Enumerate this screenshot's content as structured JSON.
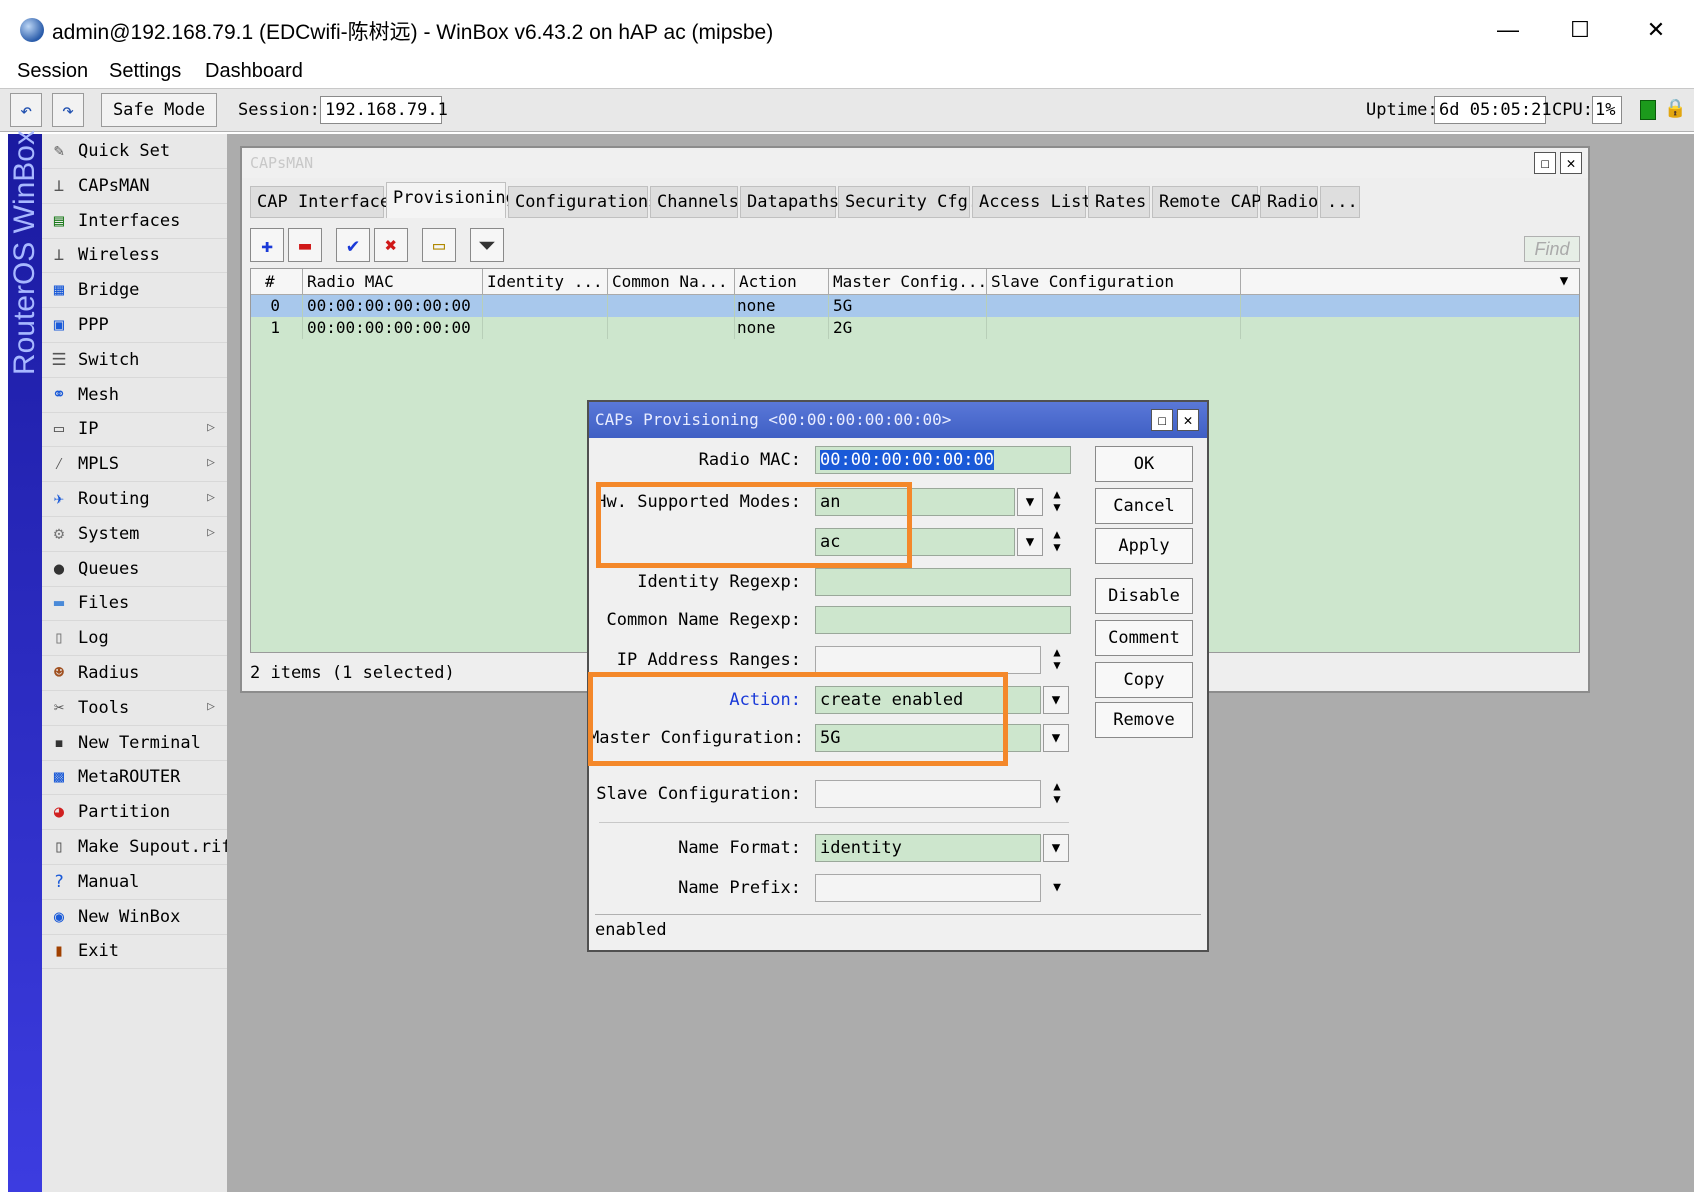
{
  "window": {
    "title": "admin@192.168.79.1 (EDCwifi-陈树远) - WinBox v6.43.2 on hAP ac (mipsbe)",
    "minimize": "—",
    "maximize": "☐",
    "close": "✕"
  },
  "menu": [
    "Session",
    "Settings",
    "Dashboard"
  ],
  "toolbar": {
    "undo": "↶",
    "redo": "↷",
    "safe_mode": "Safe Mode",
    "session_label": "Session:",
    "session_value": "192.168.79.1",
    "uptime_label": "Uptime:",
    "uptime_value": "6d 05:05:21",
    "cpu_label": "CPU:",
    "cpu_value": "1%"
  },
  "vertical_brand": "RouterOS WinBox",
  "sidebar": {
    "items": [
      {
        "label": "Quick Set",
        "icon": "✎",
        "submenu": false
      },
      {
        "label": "CAPsMAN",
        "icon": "⊥",
        "submenu": false
      },
      {
        "label": "Interfaces",
        "icon": "▤",
        "submenu": false
      },
      {
        "label": "Wireless",
        "icon": "⊥",
        "submenu": false
      },
      {
        "label": "Bridge",
        "icon": "▦",
        "submenu": false
      },
      {
        "label": "PPP",
        "icon": "▣",
        "submenu": false
      },
      {
        "label": "Switch",
        "icon": "☰",
        "submenu": false
      },
      {
        "label": "Mesh",
        "icon": "⚭",
        "submenu": false
      },
      {
        "label": "IP",
        "icon": "▭",
        "submenu": true
      },
      {
        "label": "MPLS",
        "icon": "⁄",
        "submenu": true
      },
      {
        "label": "Routing",
        "icon": "✈",
        "submenu": true
      },
      {
        "label": "System",
        "icon": "⚙",
        "submenu": true
      },
      {
        "label": "Queues",
        "icon": "●",
        "submenu": false
      },
      {
        "label": "Files",
        "icon": "▬",
        "submenu": false
      },
      {
        "label": "Log",
        "icon": "▯",
        "submenu": false
      },
      {
        "label": "Radius",
        "icon": "☻",
        "submenu": false
      },
      {
        "label": "Tools",
        "icon": "✂",
        "submenu": true
      },
      {
        "label": "New Terminal",
        "icon": "▪",
        "submenu": false
      },
      {
        "label": "MetaROUTER",
        "icon": "▩",
        "submenu": false
      },
      {
        "label": "Partition",
        "icon": "◕",
        "submenu": false
      },
      {
        "label": "Make Supout.rif",
        "icon": "▯",
        "submenu": false
      },
      {
        "label": "Manual",
        "icon": "?",
        "submenu": false
      },
      {
        "label": "New WinBox",
        "icon": "◉",
        "submenu": false
      },
      {
        "label": "Exit",
        "icon": "▮",
        "submenu": false
      }
    ],
    "submenu_arrow": "▷"
  },
  "capsman": {
    "title": "CAPsMAN",
    "tabs": [
      "CAP Interface",
      "Provisioning",
      "Configurations",
      "Channels",
      "Datapaths",
      "Security Cfg.",
      "Access List",
      "Rates",
      "Remote CAP",
      "Radio",
      "..."
    ],
    "active_tab": 1,
    "tools": {
      "add": "✚",
      "remove": "▬",
      "enable": "✔",
      "disable": "✖",
      "comment": "▭",
      "filter": "⏷"
    },
    "find": "Find",
    "columns": [
      "#",
      "Radio MAC",
      "Identity ...",
      "Common Na...",
      "Action",
      "Master Config...",
      "Slave Configuration"
    ],
    "rows": [
      {
        "num": "0",
        "radio_mac": "00:00:00:00:00:00",
        "identity": "",
        "common_name": "",
        "action": "none",
        "master": "5G",
        "slave": "",
        "selected": true
      },
      {
        "num": "1",
        "radio_mac": "00:00:00:00:00:00",
        "identity": "",
        "common_name": "",
        "action": "none",
        "master": "2G",
        "slave": "",
        "selected": false
      }
    ],
    "status": "2 items (1 selected)"
  },
  "dialog": {
    "title": "CAPs Provisioning <00:00:00:00:00:00>",
    "fields": {
      "radio_mac_label": "Radio MAC:",
      "radio_mac_value": "00:00:00:00:00:00",
      "hw_modes_label": "Hw. Supported Modes:",
      "hw_mode_1": "an",
      "hw_mode_2": "ac",
      "identity_regexp_label": "Identity Regexp:",
      "identity_regexp_value": "",
      "common_name_regexp_label": "Common Name Regexp:",
      "common_name_regexp_value": "",
      "ip_ranges_label": "IP Address Ranges:",
      "ip_ranges_value": "",
      "action_label": "Action:",
      "action_value": "create enabled",
      "master_label": "Master Configuration:",
      "master_value": "5G",
      "slave_label": "Slave Configuration:",
      "slave_value": "",
      "name_format_label": "Name Format:",
      "name_format_value": "identity",
      "name_prefix_label": "Name Prefix:",
      "name_prefix_value": ""
    },
    "buttons": [
      "OK",
      "Cancel",
      "Apply",
      "Disable",
      "Comment",
      "Copy",
      "Remove"
    ],
    "status": "enabled"
  },
  "colors": {
    "highlight_box": "#f4882a",
    "grid_bg": "#cde6cd",
    "selected_row": "#a8c8ec",
    "dialog_title": "#4f6fd0",
    "action_label": "#1a3ad8"
  }
}
